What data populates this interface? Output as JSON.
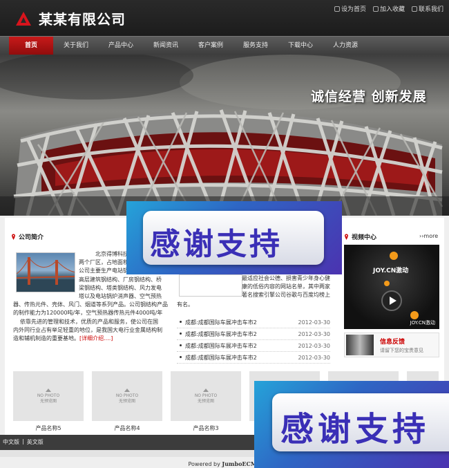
{
  "header": {
    "company_name": "某某有限公司",
    "top_links": [
      "设为首页",
      "加入收藏",
      "联系我们"
    ]
  },
  "nav": {
    "items": [
      "首页",
      "关于我们",
      "产品中心",
      "新闻资讯",
      "客户案例",
      "服务支持",
      "下载中心",
      "人力资源"
    ],
    "active_index": 0
  },
  "banner": {
    "slogan": "诚信经营 创新发展"
  },
  "about": {
    "title": "公司简介",
    "text_lines": [
      "北京得博科技有",
      "两个厂区，占地面积",
      "公司主要生产电站锅",
      "高层建筑钢结构、厂房钢结构、桥",
      "梁钢结构、塔类钢结构、风力发电",
      "塔以及电站锅炉消声器、空气预热",
      "器、传热元件、壳体、风门、烟道等系列产品。公司钢结构产品",
      "的制作能力为120000吨/年，空气预热器传热元件4000吨/年",
      "依靠先进的管理和技术，优质的产品和服务，使公司在国",
      "内外同行业占有举足轻重的地位，是我国大电行业金属结构制",
      "造和辅机制造的重要基地。"
    ],
    "more_link": "[详细介绍....]"
  },
  "news": {
    "snippet_lines": [
      "最适应社会公德、损害青少年身心健",
      "康的低俗内容的网站名单，其中两家",
      "著名搜索引擎公司谷歌与百度均榜上"
    ],
    "snippet_tail": "有名。",
    "items": [
      {
        "title": "成都:成都国际车展冲击车市2",
        "date": "2012-03-30"
      },
      {
        "title": "成都:成都国际车展冲击车市2",
        "date": "2012-03-30"
      },
      {
        "title": "成都:成都国际车展冲击车市2",
        "date": "2012-03-30"
      },
      {
        "title": "成都:成都国际车展冲击车市2",
        "date": "2012-03-30"
      }
    ]
  },
  "video": {
    "title": "视频中心",
    "more": "more",
    "brand_top": "JOY.CN激动",
    "brand_bottom": "JOY.CN激动"
  },
  "feedback": {
    "title": "信息反馈",
    "subtitle": "请留下您的宝贵意见"
  },
  "products": {
    "placeholder_line1": "NO PHOTO",
    "placeholder_line2": "无预览图",
    "items": [
      "产品名称5",
      "产品名称4",
      "产品名称3"
    ]
  },
  "footer": {
    "languages": [
      "中文版",
      "英文版"
    ],
    "separator": "|",
    "powered_prefix": "Powered by",
    "powered_brand": "JumboECMS"
  },
  "watermark": {
    "text": "感谢支持"
  },
  "colors": {
    "accent_red": "#c81a1a",
    "watermark_blue": "#2e66c4",
    "watermark_text": "#3a2fb6"
  }
}
